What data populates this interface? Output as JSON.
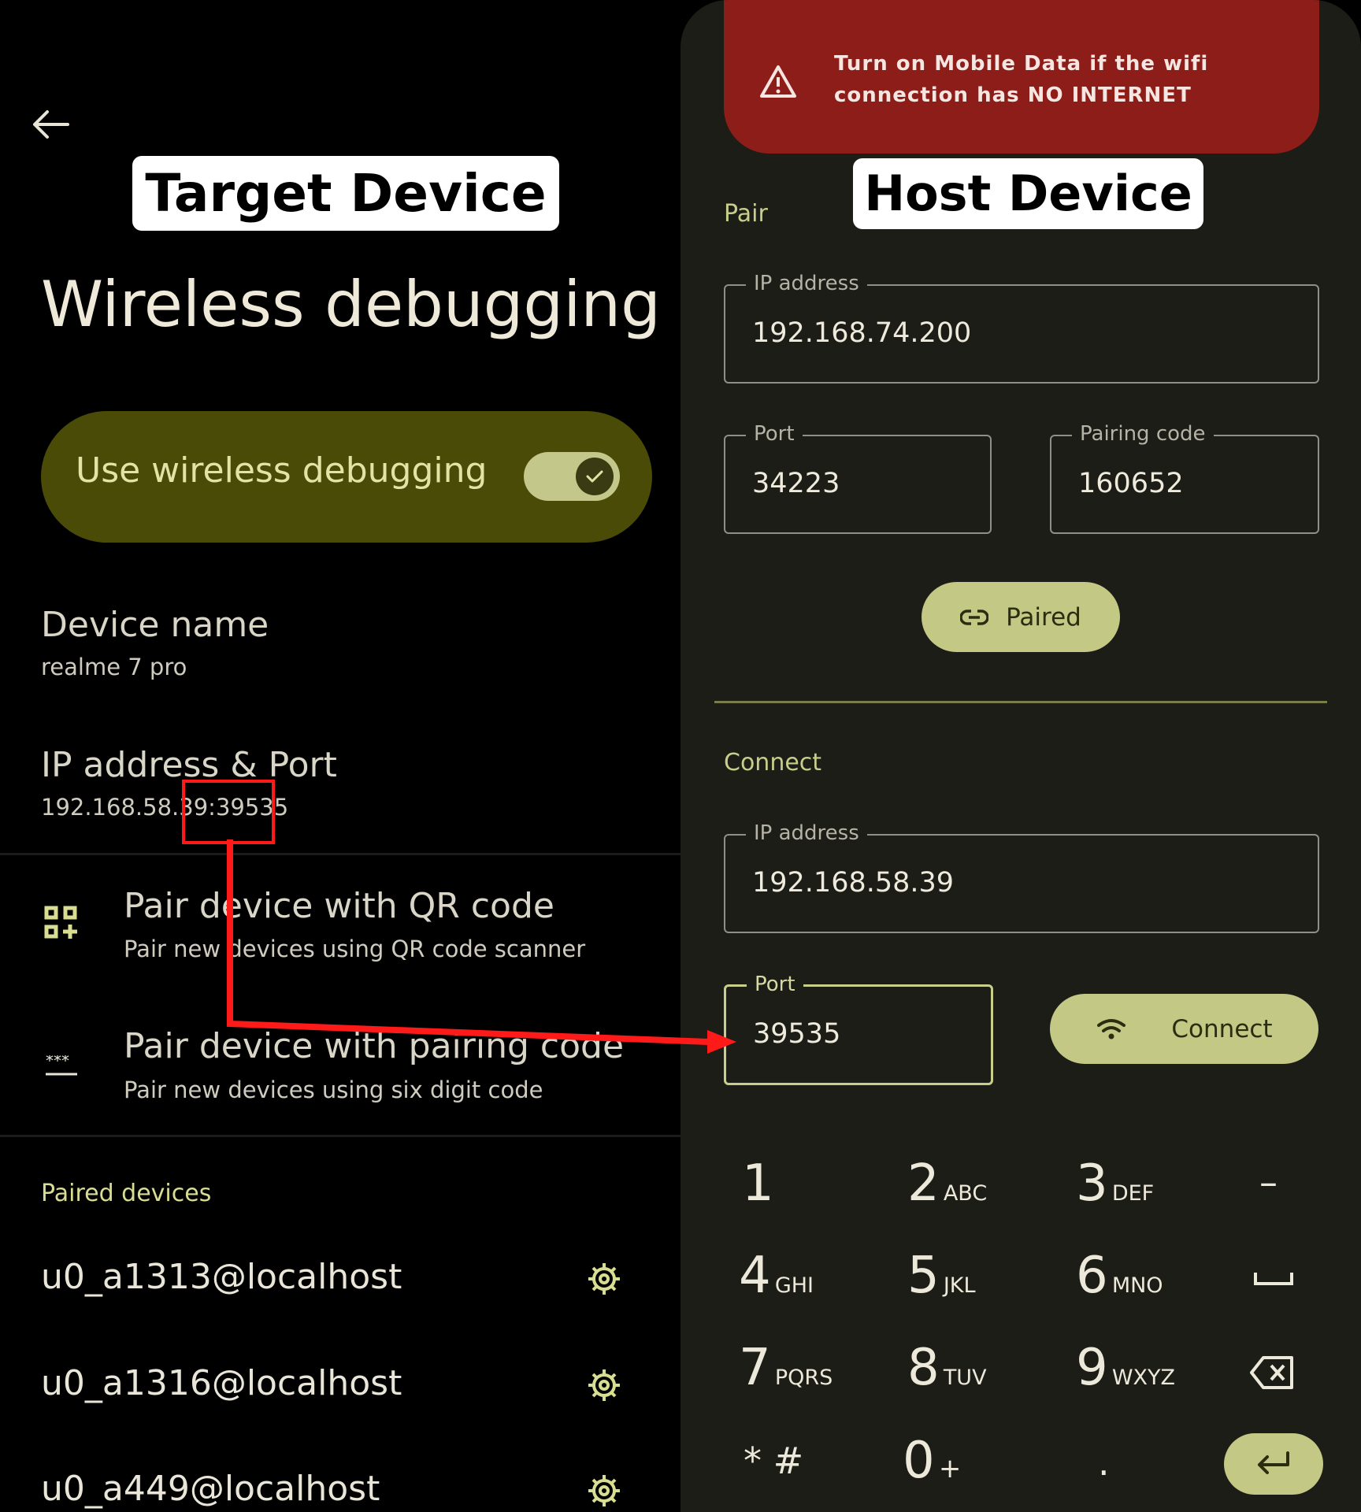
{
  "target": {
    "callout": "Target Device",
    "page_title": "Wireless debugging",
    "toggle": {
      "label": "Use wireless debugging",
      "on": true
    },
    "device_name": {
      "title": "Device name",
      "value": "realme 7 pro"
    },
    "ip_port": {
      "title": "IP address & Port",
      "ip": "192.168.58.39",
      "port": ":39535"
    },
    "pair_qr": {
      "title": "Pair device with QR code",
      "subtitle": "Pair new devices using QR code scanner"
    },
    "pair_code": {
      "title": "Pair device with pairing code",
      "subtitle": "Pair new devices using six digit code"
    },
    "paired_header": "Paired devices",
    "paired_devices": [
      "u0_a1313@localhost",
      "u0_a1316@localhost",
      "u0_a449@localhost"
    ]
  },
  "host": {
    "callout": "Host Device",
    "warning": {
      "line1": "Turn on Mobile Data if the wifi",
      "line2": "connection has NO INTERNET"
    },
    "pair": {
      "section": "Pair",
      "ip": {
        "label": "IP address",
        "value": "192.168.74.200"
      },
      "port": {
        "label": "Port",
        "value": "34223"
      },
      "code": {
        "label": "Pairing code",
        "value": "160652"
      },
      "button": "Paired"
    },
    "connect": {
      "section": "Connect",
      "ip": {
        "label": "IP address",
        "value": "192.168.58.39"
      },
      "port": {
        "label": "Port",
        "value": "39535"
      },
      "button": "Connect"
    },
    "keypad": {
      "keys": [
        {
          "d": "1",
          "l": ""
        },
        {
          "d": "2",
          "l": "ABC"
        },
        {
          "d": "3",
          "l": "DEF"
        },
        {
          "d": "4",
          "l": "GHI"
        },
        {
          "d": "5",
          "l": "JKL"
        },
        {
          "d": "6",
          "l": "MNO"
        },
        {
          "d": "7",
          "l": "PQRS"
        },
        {
          "d": "8",
          "l": "TUV"
        },
        {
          "d": "9",
          "l": "WXYZ"
        },
        {
          "d": "0",
          "l": "+"
        }
      ],
      "minus": "–",
      "star_hash": "* #",
      "dot": "."
    }
  },
  "colors": {
    "accent": "#c3c884",
    "warning": "#8c1d19",
    "highlight": "#ff1a1a"
  }
}
